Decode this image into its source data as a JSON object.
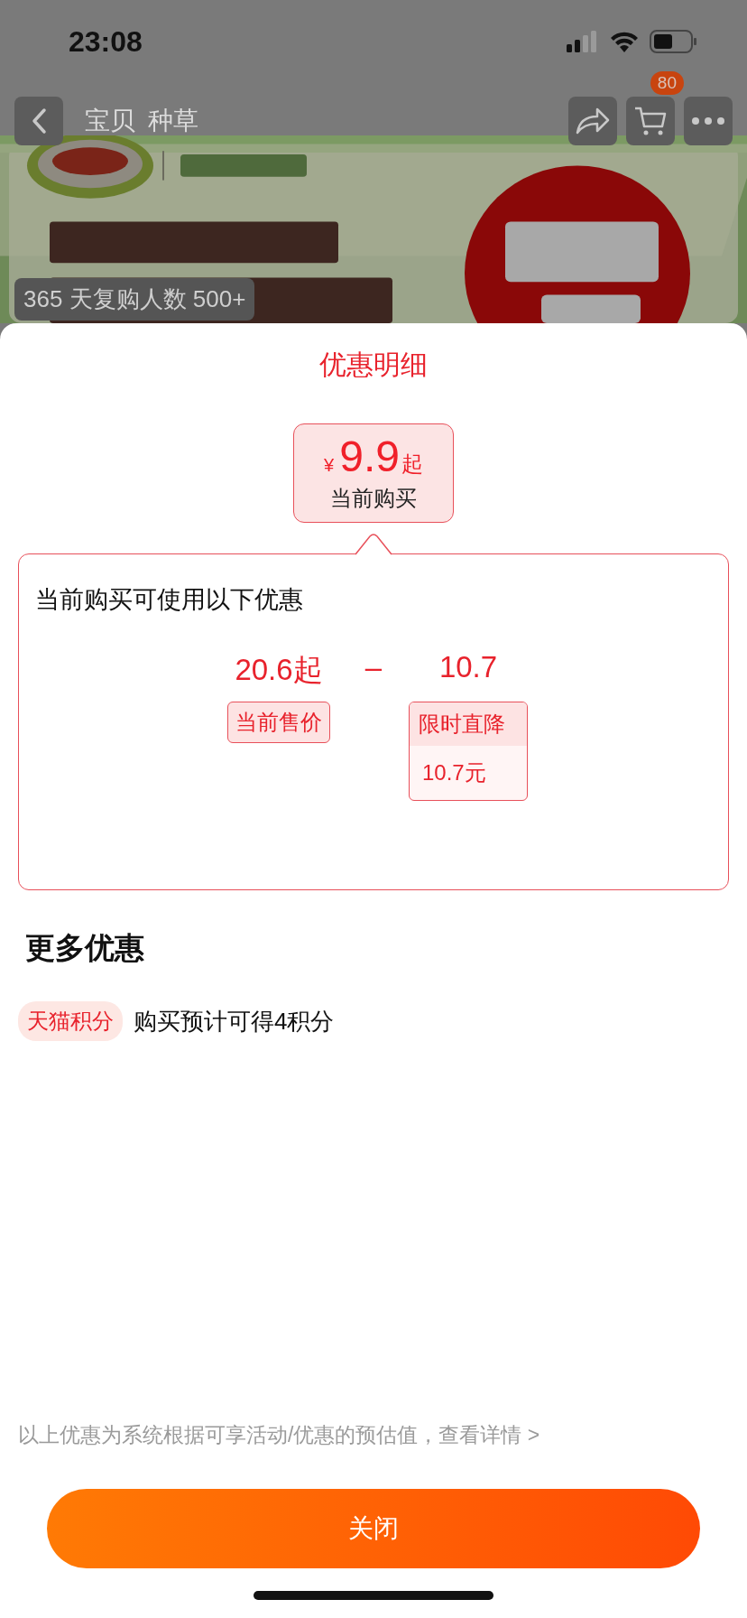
{
  "status_bar": {
    "time": "23:08"
  },
  "nav": {
    "tabs": [
      "宝贝",
      "种草"
    ],
    "cart_badge": "80"
  },
  "banner": {
    "kind": "picture",
    "badge": "365 天复购人数 500+"
  },
  "sheet": {
    "title": "优惠明细",
    "current": {
      "currency": "¥",
      "price": "9.9",
      "suffix": "起",
      "label": "当前购买"
    },
    "detail": {
      "heading": "当前购买可使用以下优惠",
      "operator": "–",
      "terms": [
        {
          "kind": "base",
          "amount": "20.6起",
          "tag": "当前售价"
        },
        {
          "kind": "discount",
          "amount": "10.7",
          "tag": "限时直降",
          "value": "10.7元"
        }
      ]
    },
    "more": {
      "heading": "更多优惠",
      "items": [
        {
          "tag": "天猫积分",
          "text": "购买预计可得4积分"
        }
      ]
    },
    "note": "以上优惠为系统根据可享活动/优惠的预估值，",
    "note_link": "查看详情 >",
    "close_button": "关闭"
  }
}
